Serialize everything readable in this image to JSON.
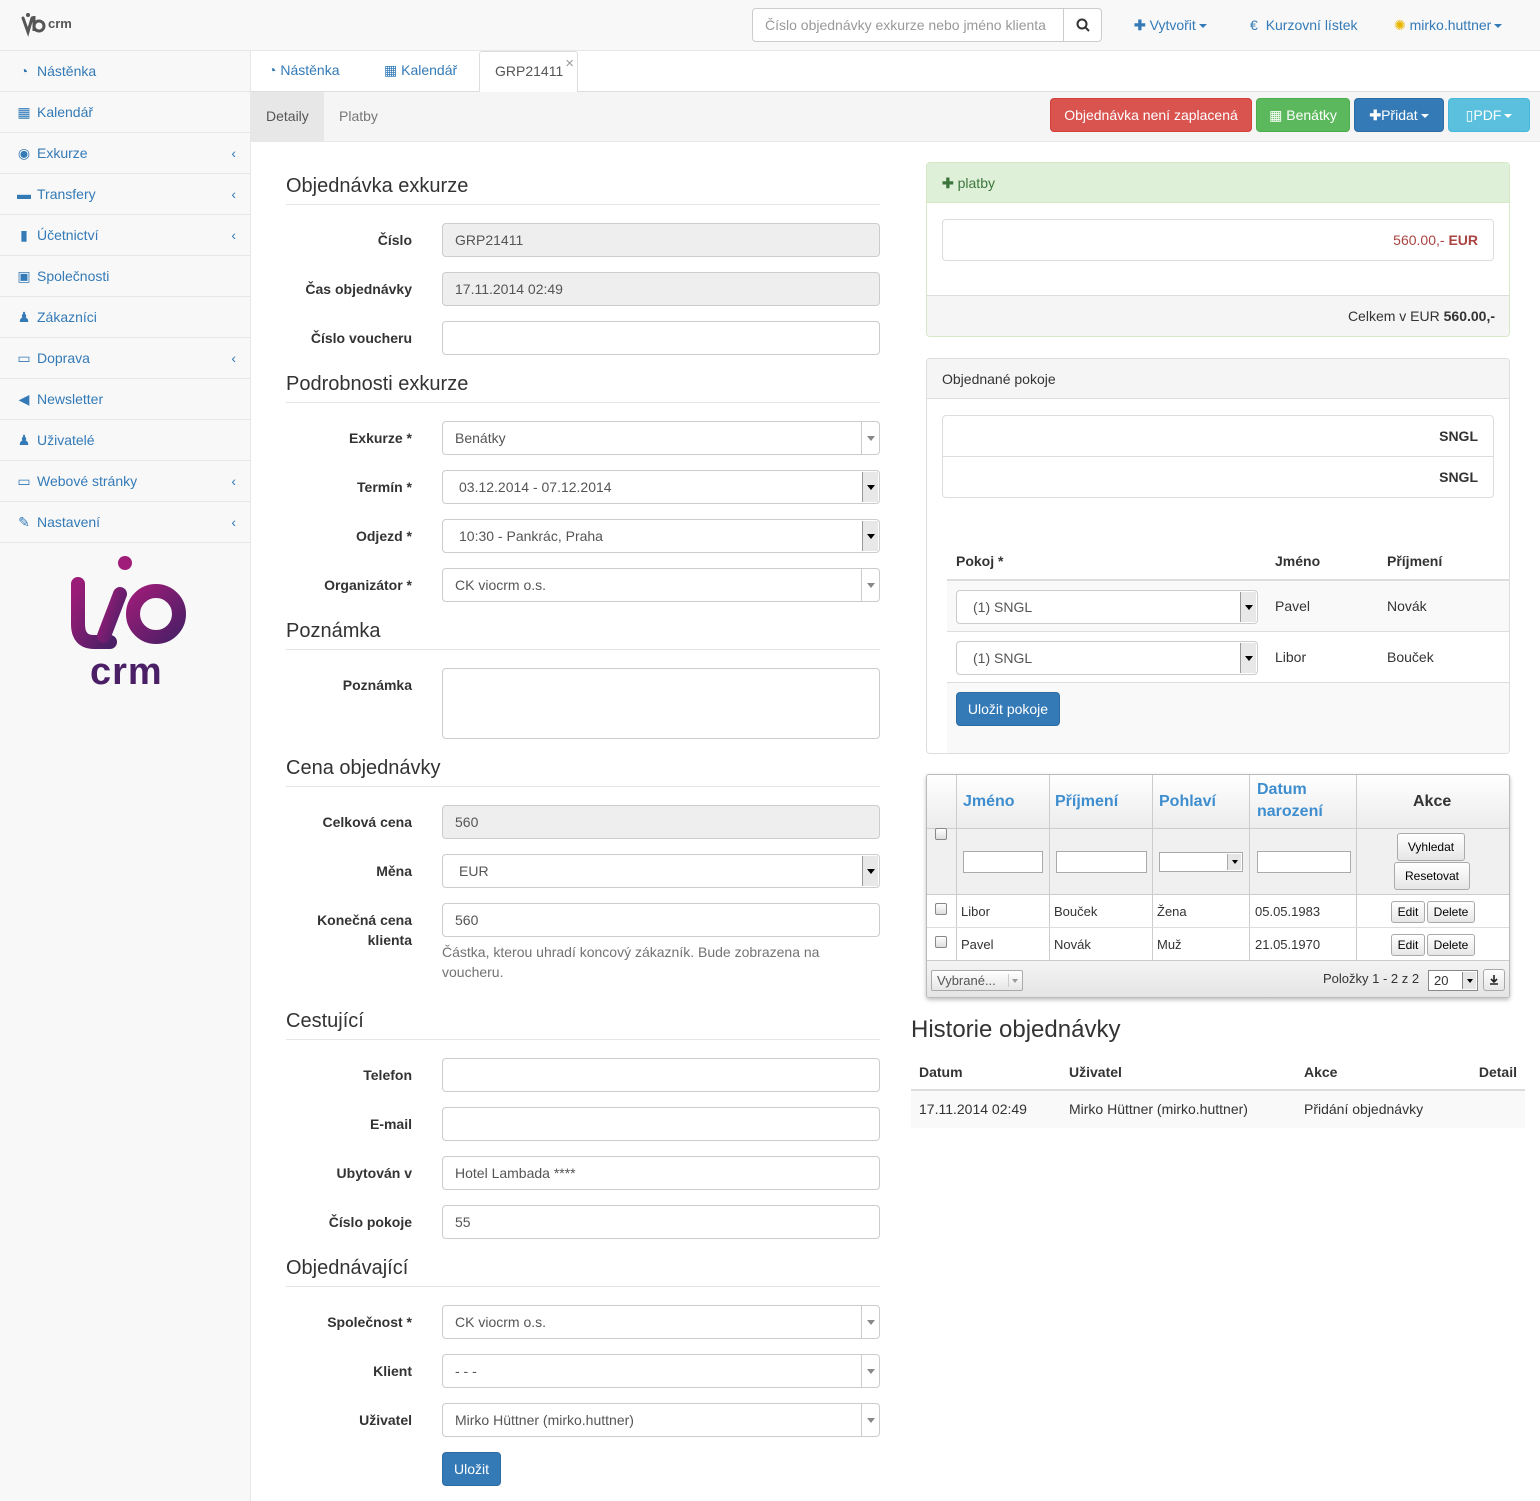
{
  "header": {
    "logo_text": "crm",
    "search_placeholder": "Číslo objednávky exkurze nebo jméno klienta",
    "create_label": "Vytvořit",
    "rates_label": "Kurzovní lístek",
    "user_label": "mirko.huttner"
  },
  "sidebar": {
    "items": [
      {
        "label": "Nástěnka",
        "icon": "dashboard-icon",
        "submenu": false
      },
      {
        "label": "Kalendář",
        "icon": "calendar-icon",
        "submenu": false
      },
      {
        "label": "Exkurze",
        "icon": "eye-icon",
        "submenu": true
      },
      {
        "label": "Transfery",
        "icon": "car-icon",
        "submenu": true
      },
      {
        "label": "Účetnictví",
        "icon": "book-icon",
        "submenu": true
      },
      {
        "label": "Společnosti",
        "icon": "briefcase-icon",
        "submenu": false
      },
      {
        "label": "Zákazníci",
        "icon": "users-icon",
        "submenu": false
      },
      {
        "label": "Doprava",
        "icon": "bus-icon",
        "submenu": true
      },
      {
        "label": "Newsletter",
        "icon": "megaphone-icon",
        "submenu": false
      },
      {
        "label": "Uživatelé",
        "icon": "user-icon",
        "submenu": false
      },
      {
        "label": "Webové stránky",
        "icon": "desktop-icon",
        "submenu": true
      },
      {
        "label": "Nastavení",
        "icon": "wrench-icon",
        "submenu": true
      }
    ],
    "logo_word": "crm"
  },
  "tabs": {
    "dashboard": "Nástěnka",
    "calendar": "Kalendář",
    "order": "GRP21411",
    "close": "×"
  },
  "subtabs": {
    "details": "Detaily",
    "payments": "Platby"
  },
  "actions": {
    "unpaid": "Objednávka není zaplacená",
    "trip": "Benátky",
    "add": "Přidat",
    "pdf": "PDF"
  },
  "form": {
    "sections": {
      "order": "Objednávka exkurze",
      "details": "Podrobnosti exkurze",
      "note": "Poznámka",
      "price": "Cena objednávky",
      "travelers": "Cestující",
      "customer": "Objednávající"
    },
    "labels": {
      "number": "Číslo",
      "time": "Čas objednávky",
      "voucher": "Číslo voucheru",
      "trip": "Exkurze *",
      "term": "Termín *",
      "departure": "Odjezd *",
      "organizer": "Organizátor *",
      "note": "Poznámka",
      "total": "Celková cena",
      "currency": "Měna",
      "final_line1": "Konečná cena",
      "final_line2": "klienta",
      "phone": "Telefon",
      "email": "E-mail",
      "hotel": "Ubytován v",
      "room": "Číslo pokoje",
      "company": "Společnost *",
      "client": "Klient",
      "user": "Uživatel"
    },
    "values": {
      "number": "GRP21411",
      "time": "17.11.2014 02:49",
      "voucher": "",
      "trip": "Benátky",
      "term": "03.12.2014 - 07.12.2014",
      "departure": "10:30 - Pankrác, Praha",
      "organizer": "CK viocrm o.s.",
      "note": "",
      "total": "560",
      "currency": "EUR",
      "final": "560",
      "phone": "",
      "email": "",
      "hotel": "Hotel Lambada ****",
      "room": "55",
      "company": "CK viocrm o.s.",
      "client": "- - -",
      "user": "Mirko Hüttner (mirko.huttner)"
    },
    "final_help": "Částka, kterou uhradí koncový zákazník. Bude zobrazena na voucheru.",
    "save": "Uložit"
  },
  "payments": {
    "header": "platby",
    "amount": "560.00,-",
    "currency": "EUR",
    "total_label": "Celkem v EUR",
    "total_value": "560.00,-"
  },
  "rooms": {
    "header": "Objednané pokoje",
    "list": [
      "SNGL",
      "SNGL"
    ],
    "columns": {
      "room": "Pokoj *",
      "name": "Jméno",
      "surname": "Příjmení"
    },
    "rows": [
      {
        "room": "(1) SNGL",
        "name": "Pavel",
        "surname": "Novák"
      },
      {
        "room": "(1) SNGL",
        "name": "Libor",
        "surname": "Bouček"
      }
    ],
    "save": "Uložit pokoje"
  },
  "grid": {
    "columns": {
      "name": "Jméno",
      "surname": "Příjmení",
      "gender": "Pohlaví",
      "birth1": "Datum",
      "birth2": "narození",
      "actions": "Akce"
    },
    "search": "Vyhledat",
    "reset": "Resetovat",
    "rows": [
      {
        "name": "Libor",
        "surname": "Bouček",
        "gender": "Žena",
        "birth": "05.05.1983"
      },
      {
        "name": "Pavel",
        "surname": "Novák",
        "gender": "Muž",
        "birth": "21.05.1970"
      }
    ],
    "edit": "Edit",
    "delete": "Delete",
    "bulk": "Vybrané...",
    "pager": "Položky 1 - 2 z 2",
    "per_page": "20"
  },
  "history": {
    "title": "Historie objednávky",
    "columns": {
      "date": "Datum",
      "user": "Uživatel",
      "action": "Akce",
      "detail": "Detail"
    },
    "rows": [
      {
        "date": "17.11.2014 02:49",
        "user": "Mirko Hüttner (mirko.huttner)",
        "action": "Přidání objednávky",
        "detail": ""
      }
    ]
  },
  "colors": {
    "link": "#337ab7",
    "danger": "#d9534f",
    "success": "#5cb85c",
    "info": "#5bc0de",
    "brand_purple": "#7b1d6e"
  }
}
